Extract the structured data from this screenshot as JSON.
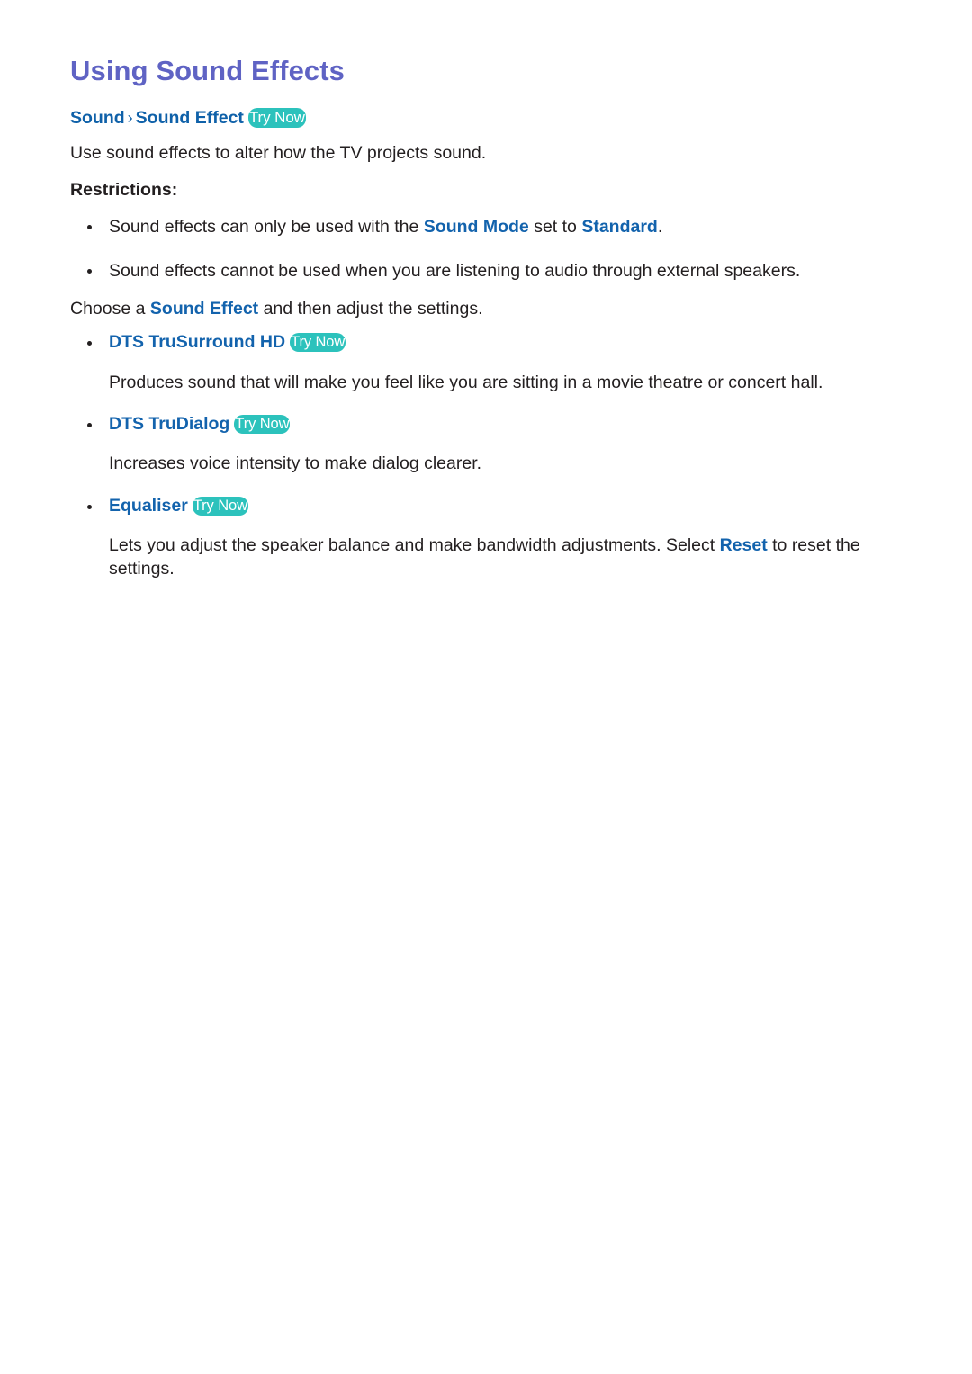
{
  "document": {
    "title": "Using Sound Effects",
    "breadcrumb": {
      "items": [
        "Sound",
        "Sound Effect"
      ],
      "separator": "›",
      "try_now_label": "Try Now"
    },
    "intro": "Use sound effects to alter how the TV projects sound.",
    "restrictions_label": "Restrictions:",
    "restrictions": [
      {
        "prefix": "Sound effects can only be used with the ",
        "link1": "Sound Mode",
        "middle": " set to ",
        "link2": "Standard",
        "suffix": "."
      },
      {
        "text": "Sound effects cannot be used when you are listening to audio through external speakers."
      }
    ],
    "choose_line": {
      "prefix": "Choose a ",
      "link": "Sound Effect",
      "suffix": " and then adjust the settings."
    },
    "options": [
      {
        "name": "DTS TruSurround HD",
        "try_now_label": "Try Now",
        "description": "Produces sound that will make you feel like you are sitting in a movie theatre or concert hall."
      },
      {
        "name": "DTS TruDialog",
        "try_now_label": "Try Now",
        "description": "Increases voice intensity to make dialog clearer."
      },
      {
        "name": "Equaliser",
        "try_now_label": "Try Now",
        "description_prefix": "Lets you adjust the speaker balance and make bandwidth adjustments. Select ",
        "description_link": "Reset",
        "description_suffix": " to reset the settings."
      }
    ]
  },
  "colors": {
    "title": "#5f63c4",
    "breadcrumb": "#0f61a9",
    "link": "#1363ad",
    "try_now_badge": "#2cc2bc",
    "try_now_text": "#ffffff",
    "body_text": "#231f20",
    "background": "#ffffff"
  }
}
